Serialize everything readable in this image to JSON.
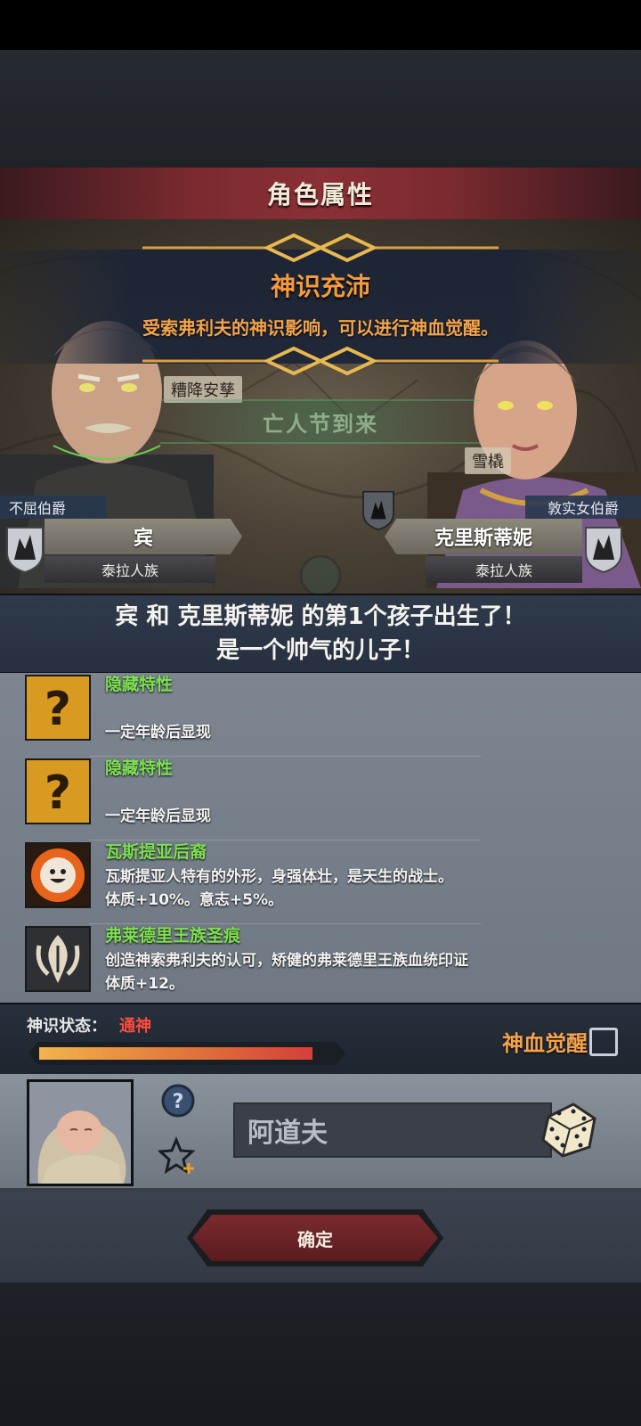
{
  "header": {
    "title": "角色属性"
  },
  "banner": {
    "title": "神识充沛",
    "description": "受索弗利夫的神识影响，可以进行神血觉醒。"
  },
  "scene": {
    "event": "亡人节到来",
    "tag_top": "糟降安孳",
    "tag_right": "雪橇"
  },
  "father": {
    "title": "不屈伯爵",
    "name": "宾",
    "race": "泰拉人族"
  },
  "mother": {
    "title": "敦实女伯爵",
    "name": "克里斯蒂妮",
    "race": "泰拉人族"
  },
  "birth": {
    "line1": "宾 和 克里斯蒂妮 的第1个孩子出生了！",
    "line2": "是一个帅气的儿子！"
  },
  "traits": [
    {
      "icon": "question-mark-icon",
      "name": "隐藏特性",
      "desc1": "",
      "desc2": "一定年龄后显现"
    },
    {
      "icon": "question-mark-icon",
      "name": "隐藏特性",
      "desc1": "",
      "desc2": "一定年龄后显现"
    },
    {
      "icon": "smiley-sun-icon",
      "name": "瓦斯提亚后裔",
      "desc1": "瓦斯提亚人特有的外形，身强体壮，是天生的战士。",
      "desc2": "体质+10%。意志+5%。"
    },
    {
      "icon": "royal-scar-icon",
      "name": "弗莱德里王族圣痕",
      "desc1": "创造神索弗利夫的认可，矫健的弗莱德里王族血统印证",
      "desc2": "体质+12。"
    }
  ],
  "status": {
    "label": "神识状态：",
    "value": "通神",
    "progress": 0.93,
    "awaken_label": "神血觉醒",
    "awaken_checked": false
  },
  "child": {
    "name_value": "阿道夫",
    "name_placeholder": "阿道夫"
  },
  "confirm_label": "确定",
  "colors": {
    "accent_orange": "#f59a3a",
    "trait_green": "#7ee052",
    "status_red": "#ff4b3d",
    "title_red": "#7a2a30"
  }
}
